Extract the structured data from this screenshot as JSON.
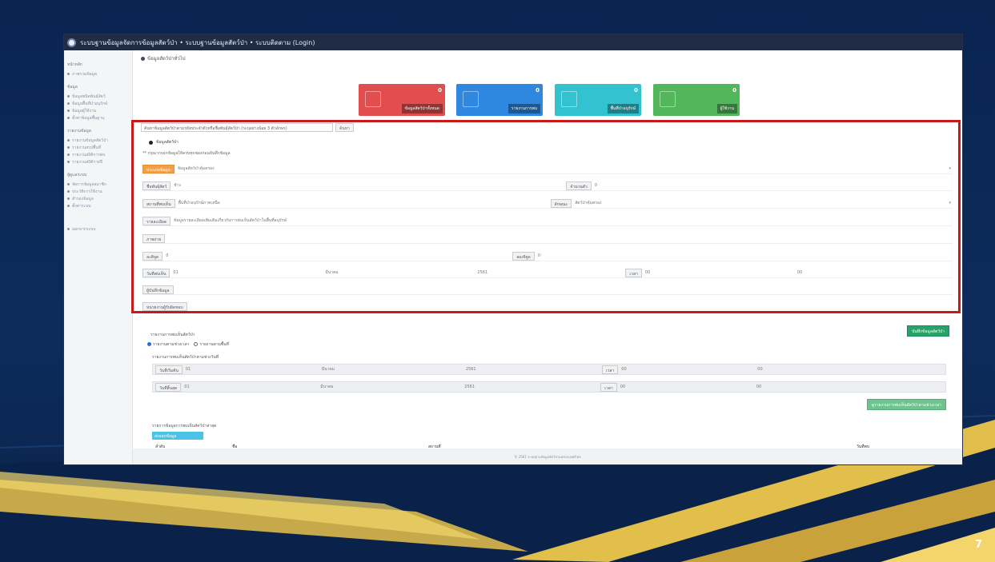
{
  "slide": {
    "page_number": "7"
  },
  "window": {
    "title": "ระบบฐานข้อมูลจัดการข้อมูลสัตว์ป่า • ระบบฐานข้อมูลสัตว์ป่า • ระบบติดตาม (Login)"
  },
  "sidebar": {
    "groups": [
      {
        "heading": "หน้าหลัก",
        "items": [
          "ภาพรวมข้อมูล"
        ]
      },
      {
        "heading": "ข้อมูล",
        "items": [
          "ข้อมูลชนิดพันธุ์สัตว์",
          "ข้อมูลพื้นที่ป่าอนุรักษ์",
          "ข้อมูลผู้ใช้งาน",
          "ตั้งค่าข้อมูลพื้นฐาน"
        ]
      },
      {
        "heading": "รายงานข้อมูล",
        "items": [
          "รายงานข้อมูลสัตว์ป่า",
          "รายงานสรุปพื้นที่",
          "รายงานสถิติการพบ",
          "รายงานสถิติรายปี"
        ]
      },
      {
        "heading": "ผู้ดูแลระบบ",
        "items": [
          "จัดการข้อมูลสมาชิก",
          "ประวัติการใช้งาน",
          "สำรองข้อมูล",
          "ตั้งค่าระบบ"
        ]
      },
      {
        "heading": "",
        "items": [
          "ออกจากระบบ"
        ]
      }
    ]
  },
  "breadcrumb": "ข้อมูลสัตว์ป่าทั่วไป",
  "cards": [
    {
      "count": "0",
      "label": "ข้อมูลสัตว์ป่าทั้งหมด",
      "color": "#e24d4d"
    },
    {
      "count": "0",
      "label": "รายงานการพบ",
      "color": "#2e88e0"
    },
    {
      "count": "0",
      "label": "พื้นที่ป่าอนุรักษ์",
      "color": "#33c2cf"
    },
    {
      "count": "0",
      "label": "ผู้ใช้งาน",
      "color": "#52b65a"
    }
  ],
  "search": {
    "value": "ค้นหาข้อมูลสัตว์ป่าตามรหัสประจำตัวหรือชื่อพันธุ์สัตว์ป่า (ระบุอย่างน้อย 3 ตัวอักษร)",
    "button": "ค้นหา"
  },
  "form": {
    "section_label": "ข้อมูลสัตว์ป่า",
    "hint": "** กรุณากรอกข้อมูลให้ครบทุกช่องก่อนบันทึกข้อมูล",
    "category_tag": "ประเภทข้อมูล",
    "category_value": "ข้อมูลสัตว์ป่าคุ้มครอง",
    "rows": [
      {
        "l_label": "ชื่อพันธุ์สัตว์",
        "l_value": "ช้าง",
        "r_label": "จำนวนตัว",
        "r_value": "0"
      },
      {
        "l_label": "สถานที่พบเห็น",
        "l_value": "พื้นที่ป่าอนุรักษ์ภาคเหนือ",
        "r_label": "ลักษณะ",
        "r_value": "สัตว์ป่าคุ้มครอง"
      },
      {
        "l_label": "รายละเอียด",
        "l_value": "ข้อมูลรายละเอียดเพิ่มเติมเกี่ยวกับการพบเห็นสัตว์ป่าในพื้นที่อนุรักษ์",
        "r_label": "",
        "r_value": ""
      },
      {
        "l_label": "ภาพถ่าย",
        "l_value": "",
        "r_label": "",
        "r_value": ""
      },
      {
        "l_label": "ละติจูด",
        "l_value": "0",
        "r_label": "ลองจิจูด",
        "r_value": "0"
      }
    ],
    "date_row": {
      "label": "วันที่พบเห็น",
      "day": "01",
      "month": "มีนาคม",
      "year": "2561",
      "time_label": "เวลา",
      "hour": "00",
      "minute": "00"
    },
    "extra1": "ผู้บันทึกข้อมูล",
    "extra2": "หน่วยงานผู้รับผิดชอบ",
    "save_button": "บันทึกข้อมูลสัตว์ป่า"
  },
  "section2": {
    "title": "รายงานการพบเห็นสัตว์ป่า",
    "radio_a": "รายงานตามช่วงเวลา",
    "radio_b": "รายงานตามพื้นที่",
    "sub_title": "รายงานการพบเห็นสัตว์ป่าตามช่วงวันที่",
    "start_label": "วันที่เริ่มต้น",
    "end_label": "วันที่สิ้นสุด",
    "day": "01",
    "month": "มีนาคม",
    "year": "2561",
    "time_label": "เวลา",
    "hour": "00",
    "minute": "00",
    "report_button": "ดูรายงานการพบเห็นสัตว์ป่าตามช่วงเวลา",
    "sub_title2": "รายการข้อมูลการพบเห็นสัตว์ป่าล่าสุด",
    "export_button": "ส่งออกข้อมูล",
    "columns": [
      "ลำดับ",
      "ชื่อ",
      "สถานที่",
      "วันที่พบ"
    ]
  },
  "footer": "© 2561 ระบบฐานข้อมูลสัตว์ป่าแห่งประเทศไทย"
}
